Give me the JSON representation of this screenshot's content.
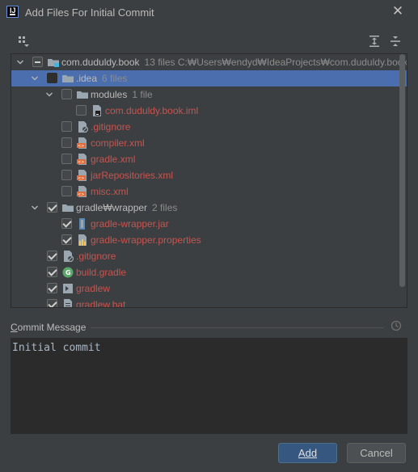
{
  "dialog": {
    "title": "Add Files For Initial Commit"
  },
  "tree": [
    {
      "level": 0,
      "expanded": true,
      "check": "partial",
      "icon": "module-folder-icon",
      "label": "com.duduldy.book",
      "meta": "13 files  C:₩Users₩endyd₩IdeaProjects₩com.duduldy.book",
      "color": "normal",
      "selected": false
    },
    {
      "level": 1,
      "expanded": true,
      "check": "indeterminate",
      "icon": "folder-icon",
      "label": ".idea",
      "meta": "6 files",
      "color": "normal",
      "selected": true
    },
    {
      "level": 2,
      "expanded": true,
      "check": "unchecked",
      "icon": "folder-icon",
      "label": "modules",
      "meta": "1 file",
      "color": "normal",
      "selected": false
    },
    {
      "level": 3,
      "expanded": null,
      "check": "unchecked",
      "icon": "iml-file-icon",
      "label": "com.duduldy.book.iml",
      "meta": "",
      "color": "red",
      "selected": false
    },
    {
      "level": 2,
      "expanded": null,
      "check": "unchecked",
      "icon": "gitignore-file-icon",
      "label": ".gitignore",
      "meta": "",
      "color": "red",
      "selected": false
    },
    {
      "level": 2,
      "expanded": null,
      "check": "unchecked",
      "icon": "xml-file-icon",
      "label": "compiler.xml",
      "meta": "",
      "color": "red",
      "selected": false
    },
    {
      "level": 2,
      "expanded": null,
      "check": "unchecked",
      "icon": "xml-file-icon",
      "label": "gradle.xml",
      "meta": "",
      "color": "red",
      "selected": false
    },
    {
      "level": 2,
      "expanded": null,
      "check": "unchecked",
      "icon": "xml-file-icon",
      "label": "jarRepositories.xml",
      "meta": "",
      "color": "red",
      "selected": false
    },
    {
      "level": 2,
      "expanded": null,
      "check": "unchecked",
      "icon": "xml-file-icon",
      "label": "misc.xml",
      "meta": "",
      "color": "red",
      "selected": false
    },
    {
      "level": 1,
      "expanded": true,
      "check": "checked",
      "icon": "folder-icon",
      "label": "gradle₩wrapper",
      "meta": "2 files",
      "color": "normal",
      "selected": false
    },
    {
      "level": 2,
      "expanded": null,
      "check": "checked",
      "icon": "jar-file-icon",
      "label": "gradle-wrapper.jar",
      "meta": "",
      "color": "red",
      "selected": false
    },
    {
      "level": 2,
      "expanded": null,
      "check": "checked",
      "icon": "properties-file-icon",
      "label": "gradle-wrapper.properties",
      "meta": "",
      "color": "red",
      "selected": false
    },
    {
      "level": 1,
      "expanded": null,
      "check": "checked",
      "icon": "gitignore-file-icon",
      "label": ".gitignore",
      "meta": "",
      "color": "red",
      "selected": false
    },
    {
      "level": 1,
      "expanded": null,
      "check": "checked",
      "icon": "gradle-file-icon",
      "label": "build.gradle",
      "meta": "",
      "color": "red",
      "selected": false
    },
    {
      "level": 1,
      "expanded": null,
      "check": "checked",
      "icon": "shell-file-icon",
      "label": "gradlew",
      "meta": "",
      "color": "red",
      "selected": false
    },
    {
      "level": 1,
      "expanded": null,
      "check": "checked",
      "icon": "text-file-icon",
      "label": "gradlew.bat",
      "meta": "",
      "color": "red",
      "selected": false
    }
  ],
  "commit": {
    "label": "Commit Message",
    "message": "Initial commit"
  },
  "buttons": {
    "add": "Add",
    "cancel": "Cancel"
  },
  "colors": {
    "background": "#3c3f41",
    "selection": "#4b6eaf",
    "unversioned_file": "#c75450",
    "primary_button": "#365880"
  }
}
